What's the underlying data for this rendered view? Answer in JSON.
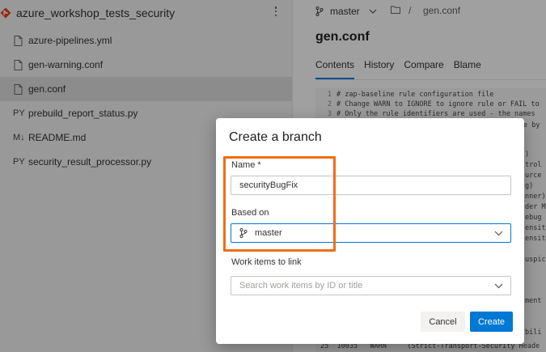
{
  "repo": {
    "name": "azure_workshop_tests_security"
  },
  "files": [
    {
      "name": "azure-pipelines.yml",
      "icon": "file-icon",
      "selected": false
    },
    {
      "name": "gen-warning.conf",
      "icon": "file-icon",
      "selected": false
    },
    {
      "name": "gen.conf",
      "icon": "file-icon",
      "selected": true
    },
    {
      "name": "prebuild_report_status.py",
      "icon": "python-icon",
      "icon_text": "PY",
      "selected": false
    },
    {
      "name": "README.md",
      "icon": "markdown-icon",
      "icon_text": "M↓",
      "selected": false
    },
    {
      "name": "security_result_processor.py",
      "icon": "python-icon",
      "icon_text": "PY",
      "selected": false
    }
  ],
  "right": {
    "branch": "master",
    "path_separator": "/",
    "path_file": "gen.conf",
    "file_title": "gen.conf",
    "tabs": [
      "Contents",
      "History",
      "Compare",
      "Blame"
    ],
    "active_tab": "Contents"
  },
  "code_lines": [
    {
      "n": "1",
      "text": "# zap-baseline rule configuration file"
    },
    {
      "n": "2",
      "text": "# Change WARN to IGNORE to ignore rule or FAIL to"
    },
    {
      "n": "3",
      "text": "# Only the rule identifiers are used - the names"
    }
  ],
  "code_fragments": [
    "e by",
    ")",
    "trol",
    "urce",
    "g)",
    "nner)",
    "der M",
    "ebug",
    "ensit",
    "ensit",
    "uspic",
    "ment",
    "bili",
    "25  10035   WARN     (Strict-Transport-Security Heade"
  ],
  "dialog": {
    "title": "Create a branch",
    "name_label": "Name *",
    "name_value": "securityBugFix",
    "based_on_label": "Based on",
    "based_on_value": "master",
    "work_items_label": "Work items to link",
    "work_items_placeholder": "Search work items by ID or title",
    "cancel_label": "Cancel",
    "create_label": "Create"
  },
  "colors": {
    "accent": "#0078d4",
    "highlight": "#f36d13",
    "selected_row": "#dcdcdc",
    "left_panel_bg": "#f0f0f0"
  }
}
